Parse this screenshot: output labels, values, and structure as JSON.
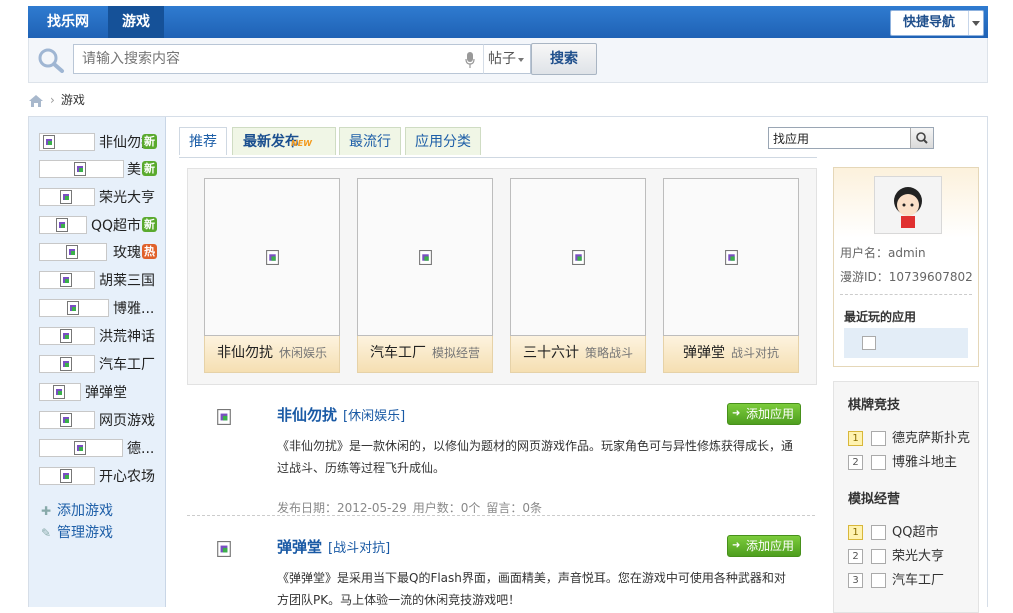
{
  "topbar": {
    "home_tab": "找乐网",
    "active_tab": "游戏",
    "quicknav": "快捷导航"
  },
  "search": {
    "placeholder": "请输入搜索内容",
    "scope": "帖子",
    "button": "搜索"
  },
  "breadcrumb": {
    "current": "游戏"
  },
  "sidebar": {
    "games": [
      {
        "name": "非仙勿扰",
        "badge": "新"
      },
      {
        "name": "美",
        "badge": "新"
      },
      {
        "name": "荣光大亨",
        "badge": ""
      },
      {
        "name": "QQ超市",
        "badge": "新"
      },
      {
        "name": "玫瑰",
        "badge": "热"
      },
      {
        "name": "胡莱三国",
        "badge": ""
      },
      {
        "name": "博雅...",
        "badge": ""
      },
      {
        "name": "洪荒神话",
        "badge": ""
      },
      {
        "name": "汽车工厂",
        "badge": ""
      },
      {
        "name": "弹弹堂",
        "badge": ""
      },
      {
        "name": "网页游戏",
        "badge": ""
      },
      {
        "name": "德...",
        "badge": ""
      },
      {
        "name": "开心农场",
        "badge": ""
      }
    ],
    "add_game": "添加游戏",
    "manage_game": "管理游戏"
  },
  "tabs": [
    {
      "label": "推荐"
    },
    {
      "label": "最新发布",
      "tag": "NEW"
    },
    {
      "label": "最流行"
    },
    {
      "label": "应用分类"
    }
  ],
  "app_search": {
    "value": "找应用"
  },
  "featured": [
    {
      "name": "非仙勿扰",
      "category": "休闲娱乐"
    },
    {
      "name": "汽车工厂",
      "category": "模拟经营"
    },
    {
      "name": "三十六计",
      "category": "策略战斗"
    },
    {
      "name": "弹弹堂",
      "category": "战斗对抗"
    }
  ],
  "entries": [
    {
      "title": "非仙勿扰",
      "category": "[休闲娱乐]",
      "add_button": "添加应用",
      "description": "《非仙勿扰》是一款休闲的，以修仙为题材的网页游戏作品。玩家角色可与异性修炼获得成长，通过战斗、历练等过程飞升成仙。",
      "date": "发布日期：2012-05-29",
      "users": "用户数：0个",
      "comments": "留言：0条"
    },
    {
      "title": "弹弹堂",
      "category": "[战斗对抗]",
      "add_button": "添加应用",
      "description": "《弹弹堂》是采用当下最Q的Flash界面，画面精美，声音悦耳。您在游戏中可使用各种武器和对方团队PK。马上体验一流的休闲竞技游戏吧！"
    }
  ],
  "user": {
    "username_label": "用户名：admin",
    "id_label": "漫游ID：10739607802",
    "recent_title": "最近玩的应用"
  },
  "rankings": [
    {
      "title": "棋牌竞技",
      "items": [
        {
          "rank": "1",
          "name": "德克萨斯扑克"
        },
        {
          "rank": "2",
          "name": "博雅斗地主"
        }
      ]
    },
    {
      "title": "模拟经营",
      "items": [
        {
          "rank": "1",
          "name": "QQ超市"
        },
        {
          "rank": "2",
          "name": "荣光大亨"
        },
        {
          "rank": "3",
          "name": "汽车工厂"
        }
      ]
    }
  ]
}
